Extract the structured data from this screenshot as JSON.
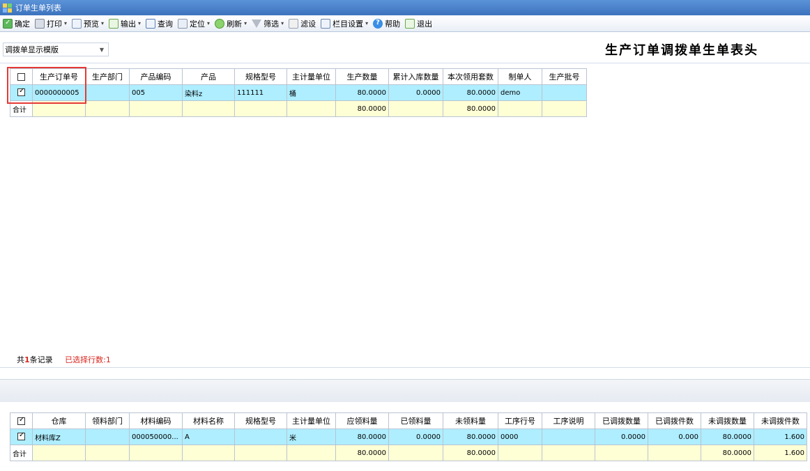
{
  "window": {
    "title": "订单生单列表"
  },
  "toolbar": {
    "items": [
      {
        "label": "确定",
        "icon": "confirm-icon",
        "dropdown": false
      },
      {
        "label": "打印",
        "icon": "print-icon",
        "dropdown": true
      },
      {
        "label": "预览",
        "icon": "preview-icon",
        "dropdown": true
      },
      {
        "label": "输出",
        "icon": "export-icon",
        "dropdown": true
      },
      {
        "label": "查询",
        "icon": "query-icon",
        "dropdown": false
      },
      {
        "label": "定位",
        "icon": "locate-icon",
        "dropdown": true
      },
      {
        "label": "刷新",
        "icon": "refresh-icon",
        "dropdown": true
      },
      {
        "label": "筛选",
        "icon": "filter-icon",
        "dropdown": true
      },
      {
        "label": "滤设",
        "icon": "filter-settings-icon",
        "dropdown": false
      },
      {
        "label": "栏目设置",
        "icon": "column-settings-icon",
        "dropdown": true
      },
      {
        "label": "帮助",
        "icon": "help-icon",
        "dropdown": false
      },
      {
        "label": "退出",
        "icon": "exit-icon",
        "dropdown": false
      }
    ]
  },
  "template_select": {
    "value": "调拨单显示模版"
  },
  "header_title": "生产订单调拨单生单表头",
  "upper_grid": {
    "columns": [
      "生产订单号",
      "生产部门",
      "产品编码",
      "产品",
      "规格型号",
      "主计量单位",
      "生产数量",
      "累计入库数量",
      "本次领用套数",
      "制单人",
      "生产批号"
    ],
    "rows": [
      {
        "checked": true,
        "cells": [
          "0000000005",
          "",
          "005",
          "染料z",
          "111111",
          "桶",
          "80.0000",
          "0.0000",
          "80.0000",
          "demo",
          ""
        ]
      }
    ],
    "total": {
      "label": "合计",
      "cells": [
        "",
        "",
        "",
        "",
        "",
        "",
        "80.0000",
        "",
        "80.0000",
        "",
        ""
      ]
    }
  },
  "status": {
    "prefix": "共",
    "count": "1",
    "suffix": "条记录",
    "selected": "已选择行数:1"
  },
  "lower_grid": {
    "header_checked": true,
    "columns": [
      "仓库",
      "领料部门",
      "材料编码",
      "材料名称",
      "规格型号",
      "主计量单位",
      "应领料量",
      "已领料量",
      "未领料量",
      "工序行号",
      "工序说明",
      "已调拨数量",
      "已调拨件数",
      "未调拨数量",
      "未调拨件数"
    ],
    "rows": [
      {
        "checked": true,
        "cells": [
          "材料库Z",
          "",
          "000050000...",
          "A",
          "",
          "米",
          "80.0000",
          "0.0000",
          "80.0000",
          "0000",
          "",
          "0.0000",
          "0.000",
          "80.0000",
          "1.600"
        ]
      }
    ],
    "total": {
      "label": "合计",
      "cells": [
        "",
        "",
        "",
        "",
        "",
        "",
        "80.0000",
        "",
        "80.0000",
        "",
        "",
        "",
        "",
        "80.0000",
        "1.600"
      ]
    }
  }
}
